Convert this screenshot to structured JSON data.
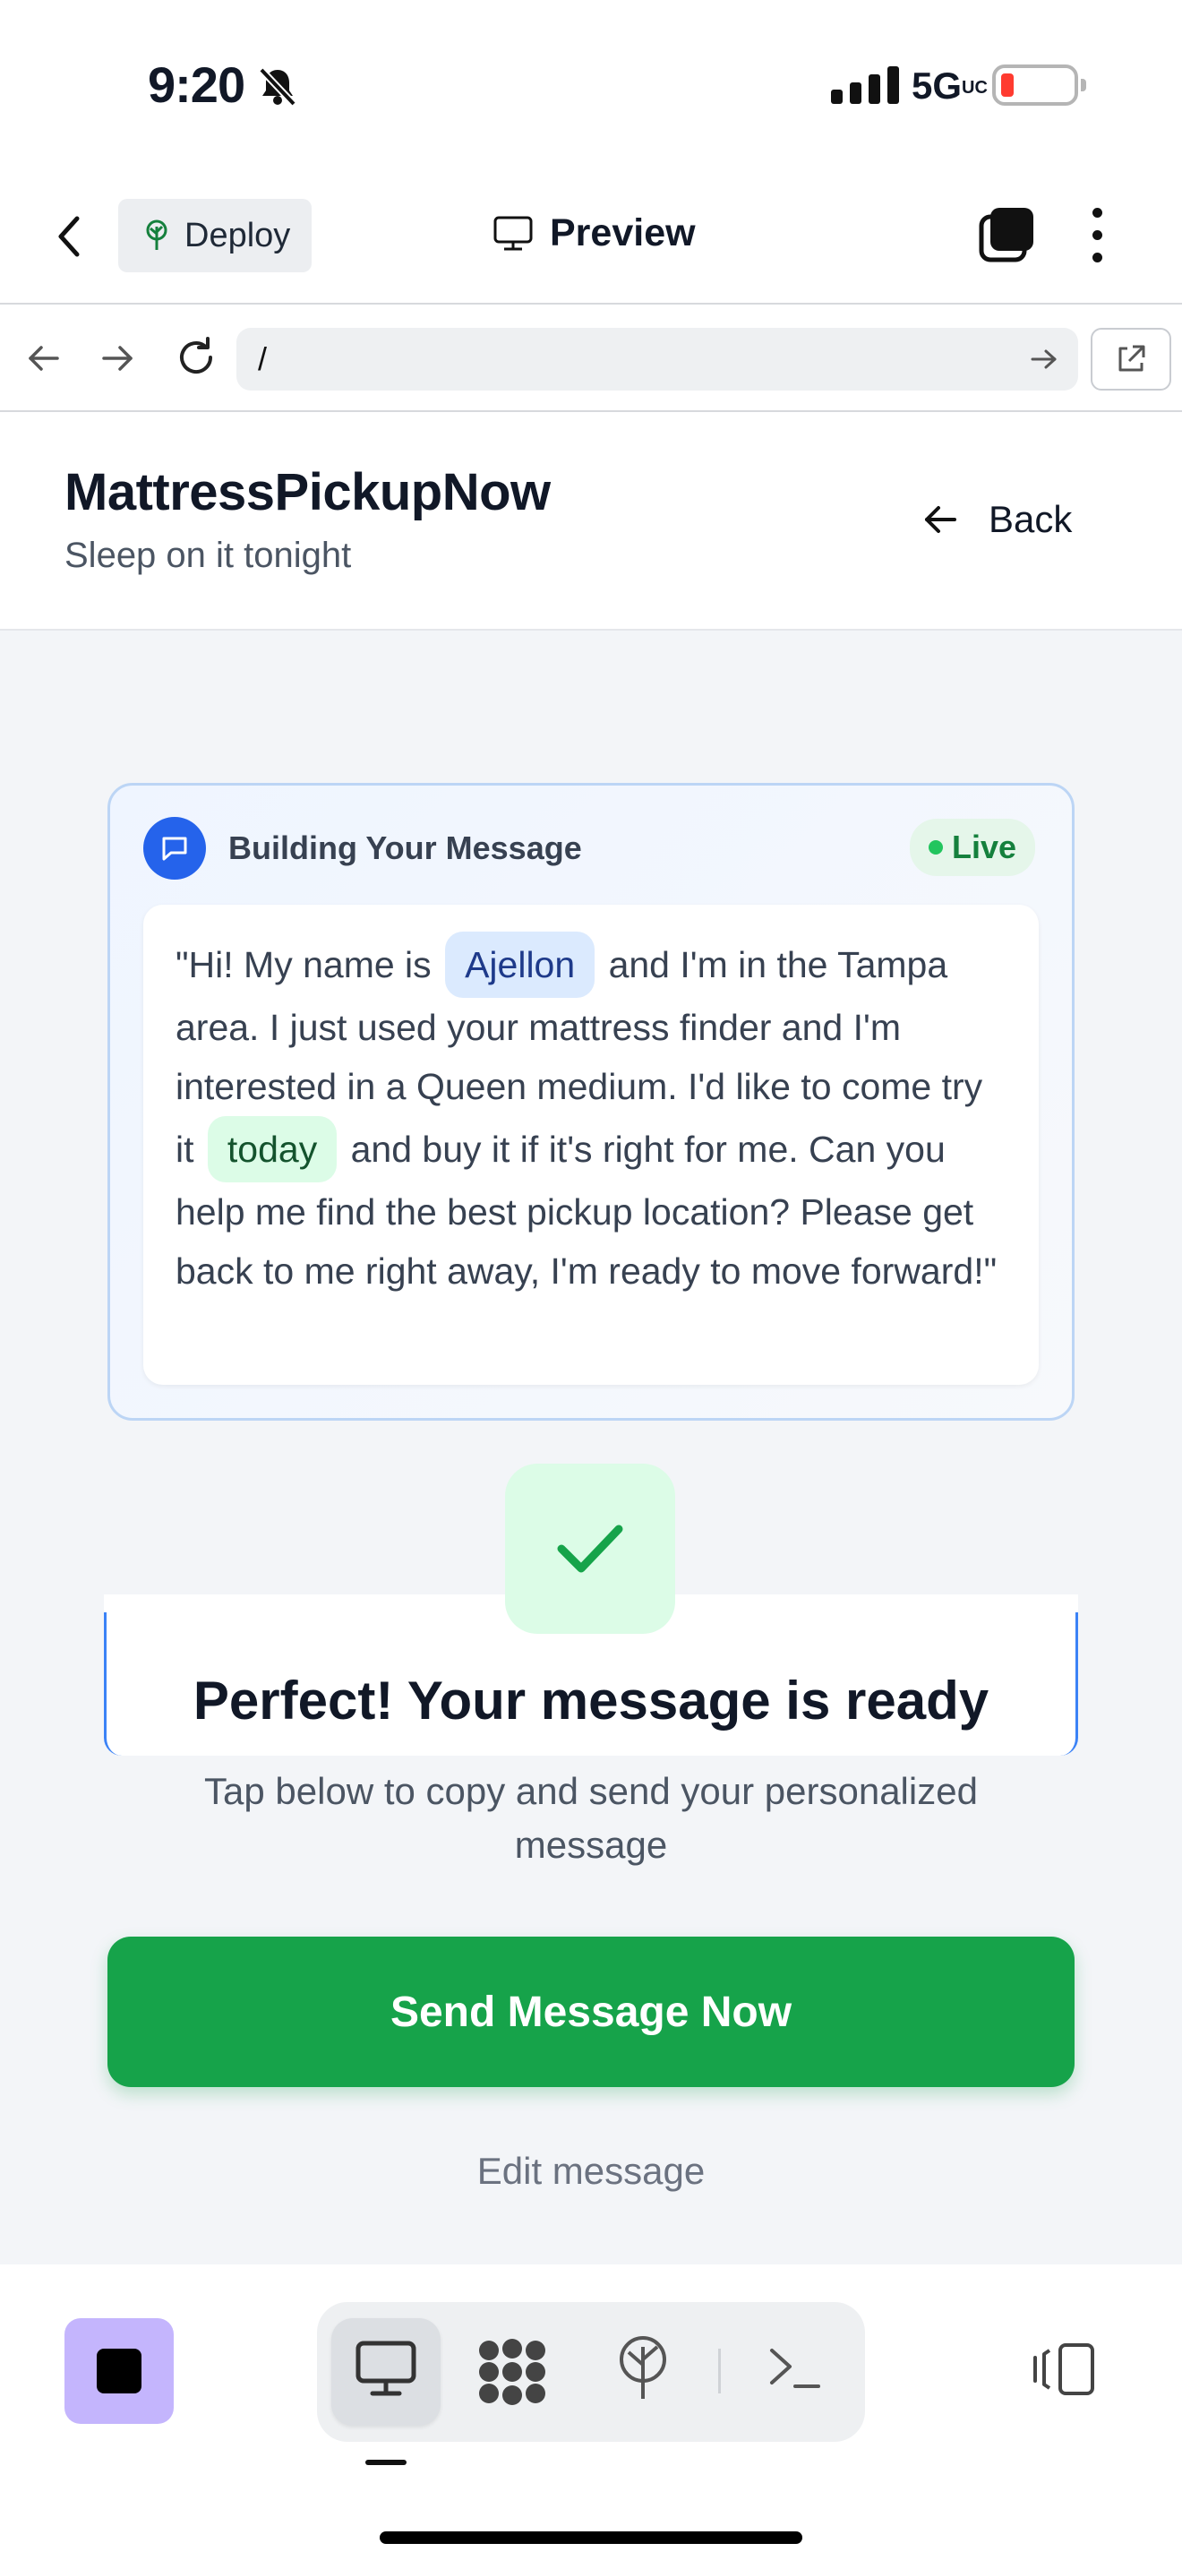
{
  "status_bar": {
    "time": "9:20",
    "network": "5G",
    "network_suffix": "UC",
    "battery_color": "#ff3b30"
  },
  "app_header": {
    "deploy_label": "Deploy",
    "preview_label": "Preview"
  },
  "browser": {
    "url": "/"
  },
  "site": {
    "title": "MattressPickupNow",
    "tagline": "Sleep on it tonight",
    "back_label": "Back"
  },
  "message_card": {
    "label": "Building Your Message",
    "live_label": "Live",
    "text_1": "\"Hi! My name is",
    "name": "Ajellon",
    "text_2": "and I'm in the Tampa area. I just used your mattress finder and I'm interested in a Queen medium. I'd like to come try it",
    "when": "today",
    "text_3": "and buy it if it's right for me. Can you help me find the best pickup location? Please get back to me right away, I'm ready to move forward!\""
  },
  "ready": {
    "title": "Perfect! Your message is ready",
    "subtitle": "Tap below to copy and send your personalized message"
  },
  "actions": {
    "send_label": "Send Message Now",
    "edit_label": "Edit message"
  },
  "colors": {
    "accent_blue": "#2563eb",
    "success_green": "#16a34a",
    "stop_purple": "#c4b5fd"
  },
  "bottom_toolbar": {
    "icons": [
      "stop-icon",
      "monitor-icon",
      "apps-grid-icon",
      "deploy-icon",
      "terminal-icon",
      "panel-toggle-icon"
    ],
    "active": "monitor-icon"
  }
}
